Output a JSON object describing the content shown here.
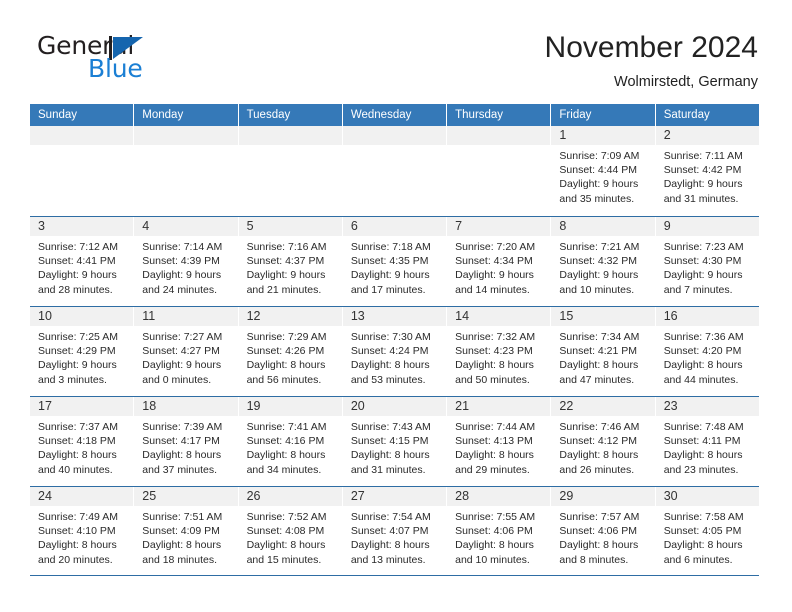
{
  "brand": {
    "word_general": "General",
    "word_blue": "Blue",
    "logo_dark": "#231f20",
    "logo_blue": "#1565ae"
  },
  "header": {
    "title": "November 2024",
    "location": "Wolmirstedt, Germany"
  },
  "theme": {
    "header_band": "#3579b8",
    "row_rule": "#2e6da4",
    "daynum_band": "#f1f1f1",
    "text": "#222222"
  },
  "calendar": {
    "weekdays": [
      "Sunday",
      "Monday",
      "Tuesday",
      "Wednesday",
      "Thursday",
      "Friday",
      "Saturday"
    ],
    "weeks": [
      [
        {
          "num": "",
          "info": ""
        },
        {
          "num": "",
          "info": ""
        },
        {
          "num": "",
          "info": ""
        },
        {
          "num": "",
          "info": ""
        },
        {
          "num": "",
          "info": ""
        },
        {
          "num": "1",
          "info": "Sunrise: 7:09 AM\nSunset: 4:44 PM\nDaylight: 9 hours\nand 35 minutes."
        },
        {
          "num": "2",
          "info": "Sunrise: 7:11 AM\nSunset: 4:42 PM\nDaylight: 9 hours\nand 31 minutes."
        }
      ],
      [
        {
          "num": "3",
          "info": "Sunrise: 7:12 AM\nSunset: 4:41 PM\nDaylight: 9 hours\nand 28 minutes."
        },
        {
          "num": "4",
          "info": "Sunrise: 7:14 AM\nSunset: 4:39 PM\nDaylight: 9 hours\nand 24 minutes."
        },
        {
          "num": "5",
          "info": "Sunrise: 7:16 AM\nSunset: 4:37 PM\nDaylight: 9 hours\nand 21 minutes."
        },
        {
          "num": "6",
          "info": "Sunrise: 7:18 AM\nSunset: 4:35 PM\nDaylight: 9 hours\nand 17 minutes."
        },
        {
          "num": "7",
          "info": "Sunrise: 7:20 AM\nSunset: 4:34 PM\nDaylight: 9 hours\nand 14 minutes."
        },
        {
          "num": "8",
          "info": "Sunrise: 7:21 AM\nSunset: 4:32 PM\nDaylight: 9 hours\nand 10 minutes."
        },
        {
          "num": "9",
          "info": "Sunrise: 7:23 AM\nSunset: 4:30 PM\nDaylight: 9 hours\nand 7 minutes."
        }
      ],
      [
        {
          "num": "10",
          "info": "Sunrise: 7:25 AM\nSunset: 4:29 PM\nDaylight: 9 hours\nand 3 minutes."
        },
        {
          "num": "11",
          "info": "Sunrise: 7:27 AM\nSunset: 4:27 PM\nDaylight: 9 hours\nand 0 minutes."
        },
        {
          "num": "12",
          "info": "Sunrise: 7:29 AM\nSunset: 4:26 PM\nDaylight: 8 hours\nand 56 minutes."
        },
        {
          "num": "13",
          "info": "Sunrise: 7:30 AM\nSunset: 4:24 PM\nDaylight: 8 hours\nand 53 minutes."
        },
        {
          "num": "14",
          "info": "Sunrise: 7:32 AM\nSunset: 4:23 PM\nDaylight: 8 hours\nand 50 minutes."
        },
        {
          "num": "15",
          "info": "Sunrise: 7:34 AM\nSunset: 4:21 PM\nDaylight: 8 hours\nand 47 minutes."
        },
        {
          "num": "16",
          "info": "Sunrise: 7:36 AM\nSunset: 4:20 PM\nDaylight: 8 hours\nand 44 minutes."
        }
      ],
      [
        {
          "num": "17",
          "info": "Sunrise: 7:37 AM\nSunset: 4:18 PM\nDaylight: 8 hours\nand 40 minutes."
        },
        {
          "num": "18",
          "info": "Sunrise: 7:39 AM\nSunset: 4:17 PM\nDaylight: 8 hours\nand 37 minutes."
        },
        {
          "num": "19",
          "info": "Sunrise: 7:41 AM\nSunset: 4:16 PM\nDaylight: 8 hours\nand 34 minutes."
        },
        {
          "num": "20",
          "info": "Sunrise: 7:43 AM\nSunset: 4:15 PM\nDaylight: 8 hours\nand 31 minutes."
        },
        {
          "num": "21",
          "info": "Sunrise: 7:44 AM\nSunset: 4:13 PM\nDaylight: 8 hours\nand 29 minutes."
        },
        {
          "num": "22",
          "info": "Sunrise: 7:46 AM\nSunset: 4:12 PM\nDaylight: 8 hours\nand 26 minutes."
        },
        {
          "num": "23",
          "info": "Sunrise: 7:48 AM\nSunset: 4:11 PM\nDaylight: 8 hours\nand 23 minutes."
        }
      ],
      [
        {
          "num": "24",
          "info": "Sunrise: 7:49 AM\nSunset: 4:10 PM\nDaylight: 8 hours\nand 20 minutes."
        },
        {
          "num": "25",
          "info": "Sunrise: 7:51 AM\nSunset: 4:09 PM\nDaylight: 8 hours\nand 18 minutes."
        },
        {
          "num": "26",
          "info": "Sunrise: 7:52 AM\nSunset: 4:08 PM\nDaylight: 8 hours\nand 15 minutes."
        },
        {
          "num": "27",
          "info": "Sunrise: 7:54 AM\nSunset: 4:07 PM\nDaylight: 8 hours\nand 13 minutes."
        },
        {
          "num": "28",
          "info": "Sunrise: 7:55 AM\nSunset: 4:06 PM\nDaylight: 8 hours\nand 10 minutes."
        },
        {
          "num": "29",
          "info": "Sunrise: 7:57 AM\nSunset: 4:06 PM\nDaylight: 8 hours\nand 8 minutes."
        },
        {
          "num": "30",
          "info": "Sunrise: 7:58 AM\nSunset: 4:05 PM\nDaylight: 8 hours\nand 6 minutes."
        }
      ]
    ]
  }
}
